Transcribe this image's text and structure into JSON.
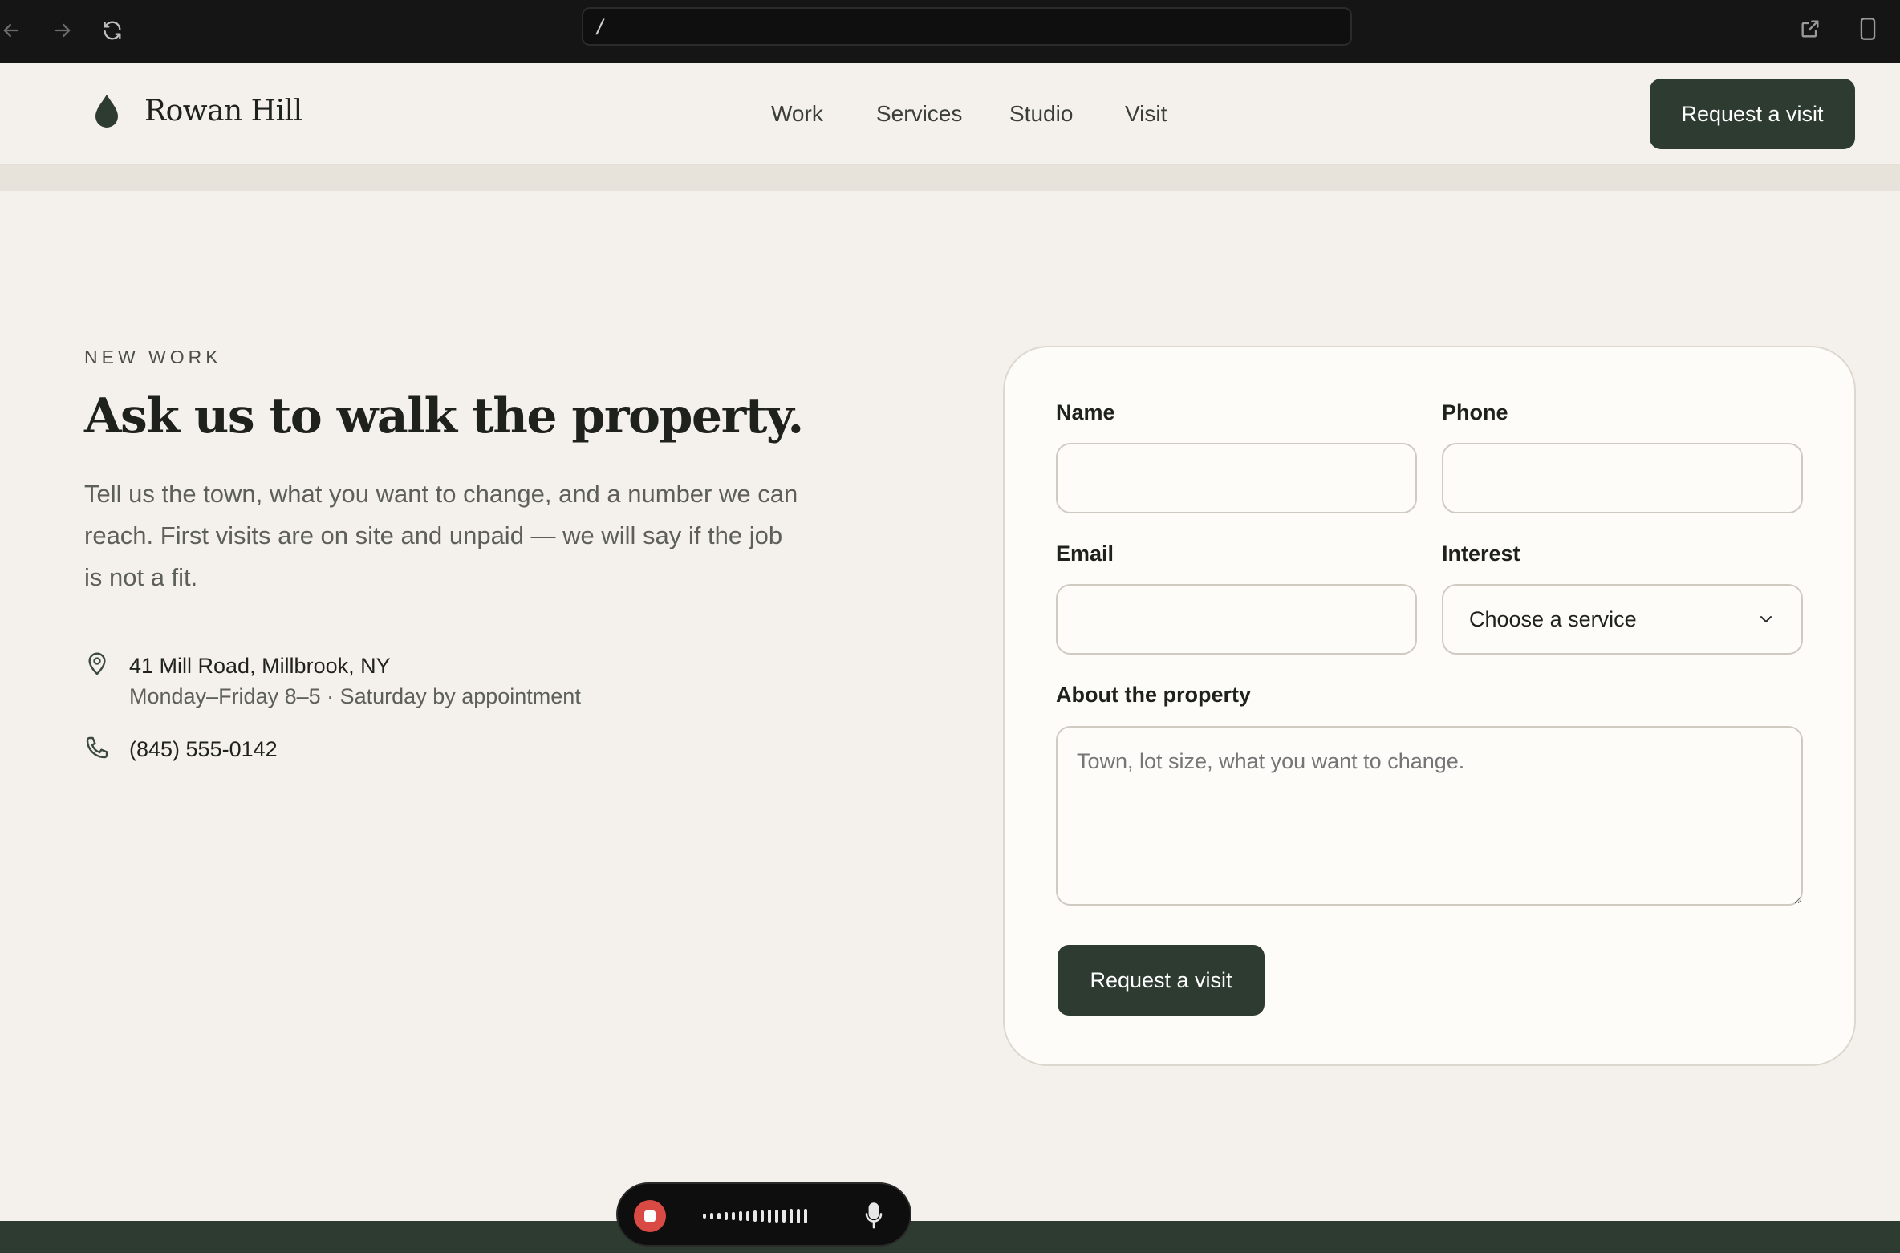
{
  "browser": {
    "url": "/"
  },
  "brand": {
    "name": "Rowan Hill"
  },
  "nav": {
    "items": [
      "Work",
      "Services",
      "Studio",
      "Visit"
    ],
    "cta": "Request a visit"
  },
  "intro": {
    "eyebrow": "NEW WORK",
    "headline": "Ask us to walk the property.",
    "body": "Tell us the town, what you want to change, and a number we can reach. First visits are on site and unpaid — we will say if the job is not a fit."
  },
  "contact": {
    "address": "41 Mill Road, Millbrook, NY",
    "hours": "Monday–Friday 8–5 · Saturday by appointment",
    "phone": "(845) 555-0142"
  },
  "form": {
    "name_label": "Name",
    "phone_label": "Phone",
    "email_label": "Email",
    "interest_label": "Interest",
    "interest_value": "Choose a service",
    "about_label": "About the property",
    "about_placeholder": "Town, lot size, what you want to change.",
    "submit_label": "Request a visit"
  },
  "colors": {
    "accent": "#2e3b31",
    "background": "#f4f0eb",
    "card": "#fdfcf9",
    "record": "#d94a44"
  },
  "icons": {
    "back": "arrow-left-icon",
    "forward": "arrow-right-icon",
    "reload": "reload-icon",
    "external": "external-link-icon",
    "device": "device-icon",
    "logo": "leaf-drop-icon",
    "address": "map-pin-icon",
    "phone": "phone-icon",
    "select": "chevron-down-icon",
    "mic": "microphone-icon"
  }
}
